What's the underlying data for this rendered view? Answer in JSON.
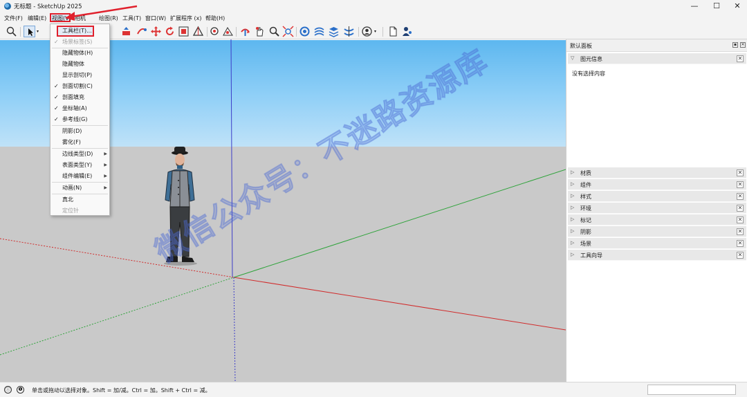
{
  "window": {
    "title": "无标题 - SketchUp 2025",
    "minimize": "—",
    "maximize": "☐",
    "close": "✕"
  },
  "menubar": {
    "items": [
      "文件(F)",
      "编辑(E)",
      "视图(V)",
      "相机",
      "绘图(R)",
      "工具(T)",
      "窗口(W)",
      "扩展程序 (x)",
      "帮助(H)"
    ]
  },
  "toolbar": {
    "icons": [
      "search-icon",
      "select-arrow-icon",
      "pushpull-icon",
      "move-icon",
      "rotate-icon",
      "scale-icon",
      "tape-icon",
      "orbit-icon",
      "pan-icon",
      "zoom-icon",
      "zoom-extents-icon",
      "sandbox-icon",
      "user-icon",
      "new-file-icon",
      "person-icon"
    ]
  },
  "view_menu": {
    "items": [
      {
        "label": "工具栏(T)...",
        "checked": false,
        "disabled": false,
        "submenu": false
      },
      {
        "label": "场景标签(S)",
        "checked": true,
        "disabled": true,
        "submenu": false
      },
      {
        "label": "隐藏物体(H)",
        "checked": false,
        "disabled": false,
        "submenu": false
      },
      {
        "label": "隐藏物体",
        "checked": false,
        "disabled": false,
        "submenu": false
      },
      {
        "label": "显示剖切(P)",
        "checked": false,
        "disabled": false,
        "submenu": false
      },
      {
        "label": "剖面切割(C)",
        "checked": true,
        "disabled": false,
        "submenu": false
      },
      {
        "label": "剖面填充",
        "checked": true,
        "disabled": false,
        "submenu": false
      },
      {
        "label": "坐标轴(A)",
        "checked": true,
        "disabled": false,
        "submenu": false
      },
      {
        "label": "参考线(G)",
        "checked": true,
        "disabled": false,
        "submenu": false
      },
      {
        "label": "阴影(D)",
        "checked": false,
        "disabled": false,
        "submenu": false
      },
      {
        "label": "雾化(F)",
        "checked": false,
        "disabled": false,
        "submenu": false
      },
      {
        "label": "边线类型(D)",
        "checked": false,
        "disabled": false,
        "submenu": true
      },
      {
        "label": "表面类型(Y)",
        "checked": false,
        "disabled": false,
        "submenu": true
      },
      {
        "label": "组件编辑(E)",
        "checked": false,
        "disabled": false,
        "submenu": true
      },
      {
        "label": "动画(N)",
        "checked": false,
        "disabled": false,
        "submenu": true
      },
      {
        "label": "真北",
        "checked": false,
        "disabled": false,
        "submenu": false
      },
      {
        "label": "定位针",
        "checked": false,
        "disabled": true,
        "submenu": false
      }
    ]
  },
  "tray": {
    "title": "默认面板",
    "entity_info": {
      "label": "图元信息",
      "message": "没有选择内容"
    },
    "panels": [
      "材质",
      "组件",
      "样式",
      "环境",
      "标记",
      "阴影",
      "场景",
      "工具向导"
    ]
  },
  "watermark": "微信公众号：不迷路资源库",
  "status": {
    "text": "单击或拖动以选择对象。Shift = 加/减。Ctrl = 加。Shift + Ctrl = 减。",
    "info_icon": "ⓘ",
    "help_icon": "❶"
  },
  "colors": {
    "sky": "#5db7ef",
    "ground": "#c9c9c9",
    "highlight": "#e0202c",
    "axis_red": "#d12a2a",
    "axis_green": "#2ea33a",
    "axis_blue": "#3c3cc8"
  }
}
